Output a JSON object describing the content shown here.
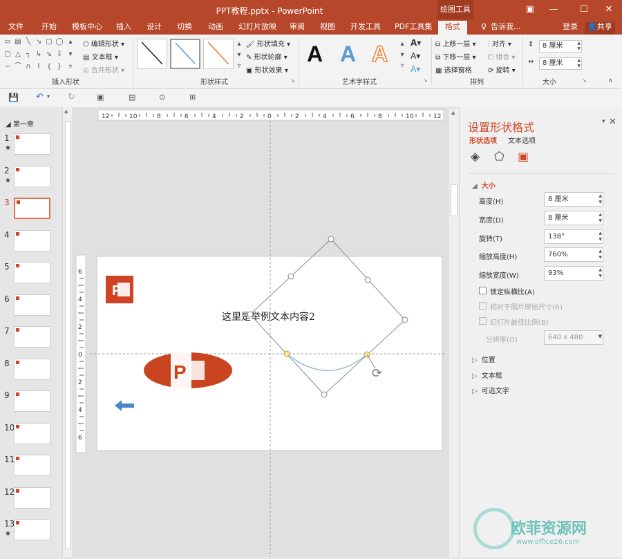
{
  "window": {
    "title": "PPT教程.pptx - PowerPoint",
    "context_tab": "绘图工具",
    "controls": [
      "▣",
      "—",
      "☐",
      "✕"
    ]
  },
  "tabs": [
    "文件",
    "开始",
    "模板中心",
    "插入",
    "设计",
    "切换",
    "动画",
    "幻灯片放映",
    "审阅",
    "视图",
    "开发工具",
    "PDF工具集",
    "格式"
  ],
  "active_tab": "格式",
  "tell_me": "告诉我...",
  "login": "登录",
  "share": "共享",
  "ribbon": {
    "insert_shapes": {
      "label": "插入形状",
      "edit_shape": "编辑形状",
      "text_box": "文本框",
      "merge_shapes": "合并形状"
    },
    "shape_styles": {
      "label": "形状样式",
      "fill": "形状填充",
      "outline": "形状轮廓",
      "effects": "形状效果"
    },
    "wordart": {
      "label": "艺术字样式",
      "letter": "A"
    },
    "arrange": {
      "label": "排列",
      "bring_forward": "上移一层",
      "send_backward": "下移一层",
      "selection_pane": "选择窗格",
      "align": "对齐",
      "group": "组合",
      "rotate": "旋转"
    },
    "size": {
      "label": "大小",
      "height": "8 厘米",
      "width": "8 厘米"
    }
  },
  "thumbnails": {
    "section": "第一章",
    "items": [
      {
        "num": "1",
        "star": true
      },
      {
        "num": "2",
        "star": true
      },
      {
        "num": "3",
        "star": false
      },
      {
        "num": "4",
        "star": false
      },
      {
        "num": "5",
        "star": false
      },
      {
        "num": "6",
        "star": false
      },
      {
        "num": "7",
        "star": false
      },
      {
        "num": "8",
        "star": false
      },
      {
        "num": "9",
        "star": false
      },
      {
        "num": "10",
        "star": false
      },
      {
        "num": "11",
        "star": false
      },
      {
        "num": "12",
        "star": false
      },
      {
        "num": "13",
        "star": true
      }
    ],
    "active_index": 2
  },
  "ruler": {
    "top_ticks": [
      "12",
      "10",
      "8",
      "6",
      "4",
      "2",
      "0",
      "2",
      "4",
      "6",
      "8",
      "10",
      "12"
    ],
    "left_ticks": [
      "6",
      "4",
      "2",
      "0",
      "2",
      "4",
      "6"
    ]
  },
  "slide": {
    "text": "这里是举例文本内容2"
  },
  "format_pane": {
    "title": "设置形状格式",
    "tab_shape": "形状选项",
    "tab_text": "文本选项",
    "section_size": "大小",
    "height_label": "高度(H)",
    "height_value": "8 厘米",
    "width_label": "宽度(D)",
    "width_value": "8 厘米",
    "rotate_label": "旋转(T)",
    "rotate_value": "138°",
    "scale_h_label": "缩放高度(H)",
    "scale_h_value": "760%",
    "scale_w_label": "缩放宽度(W)",
    "scale_w_value": "93%",
    "lock_ratio": "锁定纵横比(A)",
    "relative_original": "相对于图片原始尺寸(R)",
    "best_scale": "幻灯片最佳比例(B)",
    "resolution_label": "分辨率(O)",
    "resolution_value": "640 x 480",
    "section_position": "位置",
    "section_textbox": "文本框",
    "section_alt_text": "可选文字"
  },
  "watermark": {
    "brand": "欧菲资源网",
    "url": "www.office26.com"
  },
  "colors": {
    "accent": "#b7472a",
    "active_tab_text": "#b7472a",
    "panel_title": "#d24726",
    "arc": "#7fb3d8",
    "arrow": "#4a86c5"
  }
}
